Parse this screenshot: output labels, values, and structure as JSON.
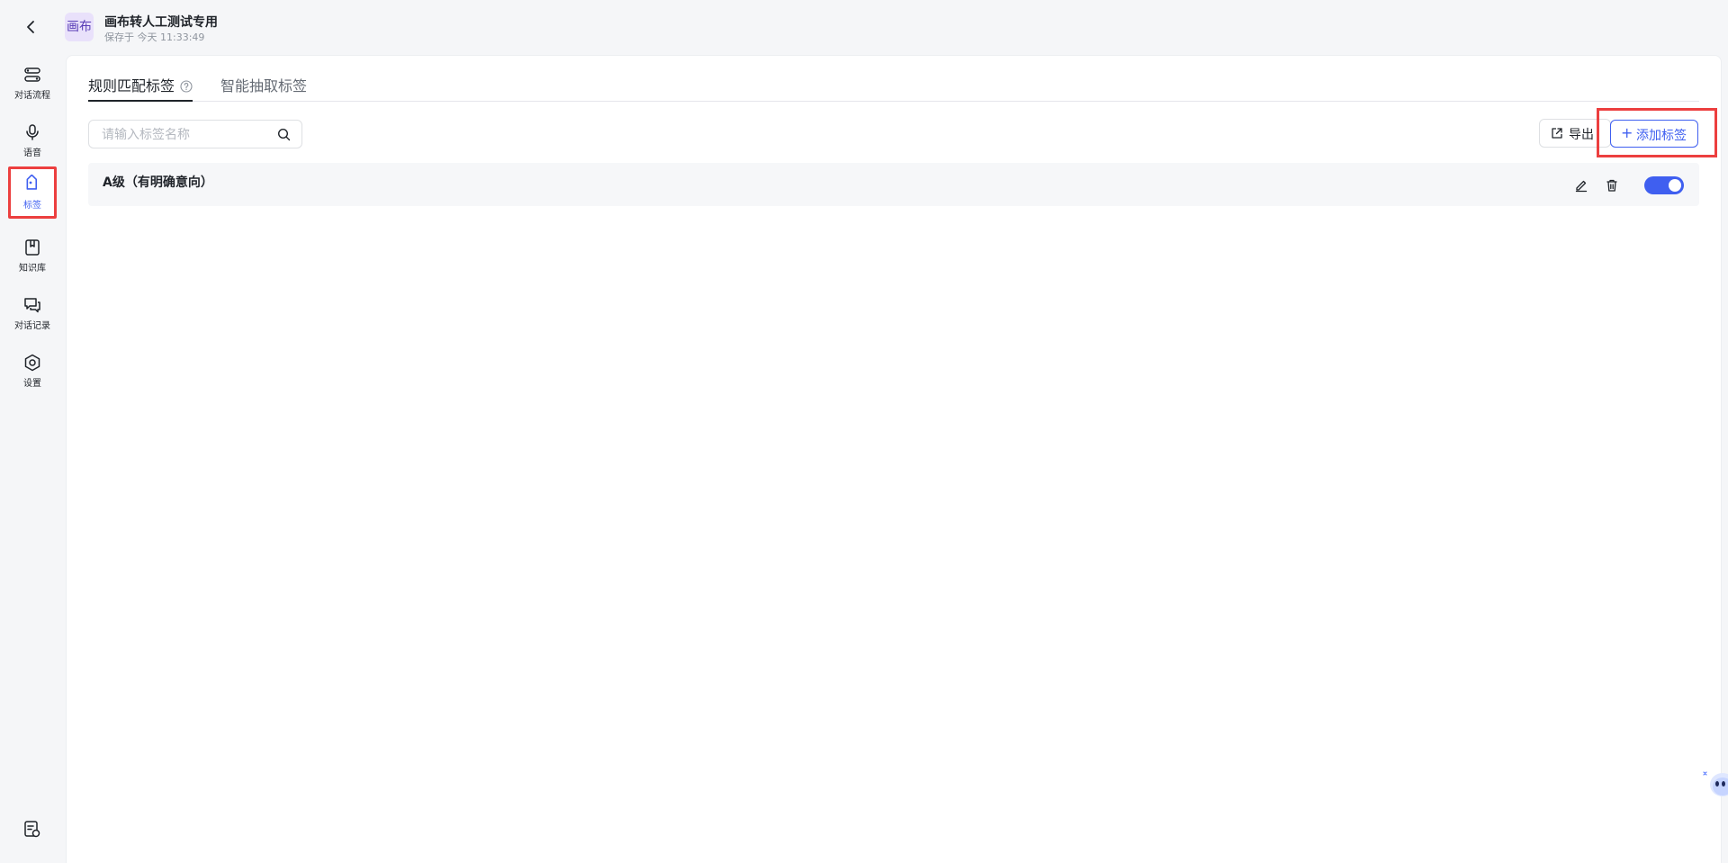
{
  "header": {
    "badge": "画布",
    "title": "画布转人工测试专用",
    "saved": "保存于 今天 11:33:49"
  },
  "sidebar": {
    "items": [
      {
        "label": "对话流程",
        "icon": "flow-icon"
      },
      {
        "label": "语音",
        "icon": "microphone-icon"
      },
      {
        "label": "标签",
        "icon": "tag-icon",
        "active": true
      },
      {
        "label": "知识库",
        "icon": "book-icon"
      },
      {
        "label": "对话记录",
        "icon": "chat-icon"
      },
      {
        "label": "设置",
        "icon": "gear-icon"
      }
    ]
  },
  "tabs": [
    {
      "label": "规则匹配标签",
      "active": true
    },
    {
      "label": "智能抽取标签",
      "active": false
    }
  ],
  "search": {
    "placeholder": "请输入标签名称",
    "value": ""
  },
  "toolbar": {
    "export_label": "导出",
    "add_label": "添加标签"
  },
  "tags": [
    {
      "name": "A级（有明确意向）",
      "enabled": true
    }
  ],
  "colors": {
    "accent": "#3f5ff0",
    "highlight": "#ec3f3f",
    "background": "#f5f6f8"
  }
}
